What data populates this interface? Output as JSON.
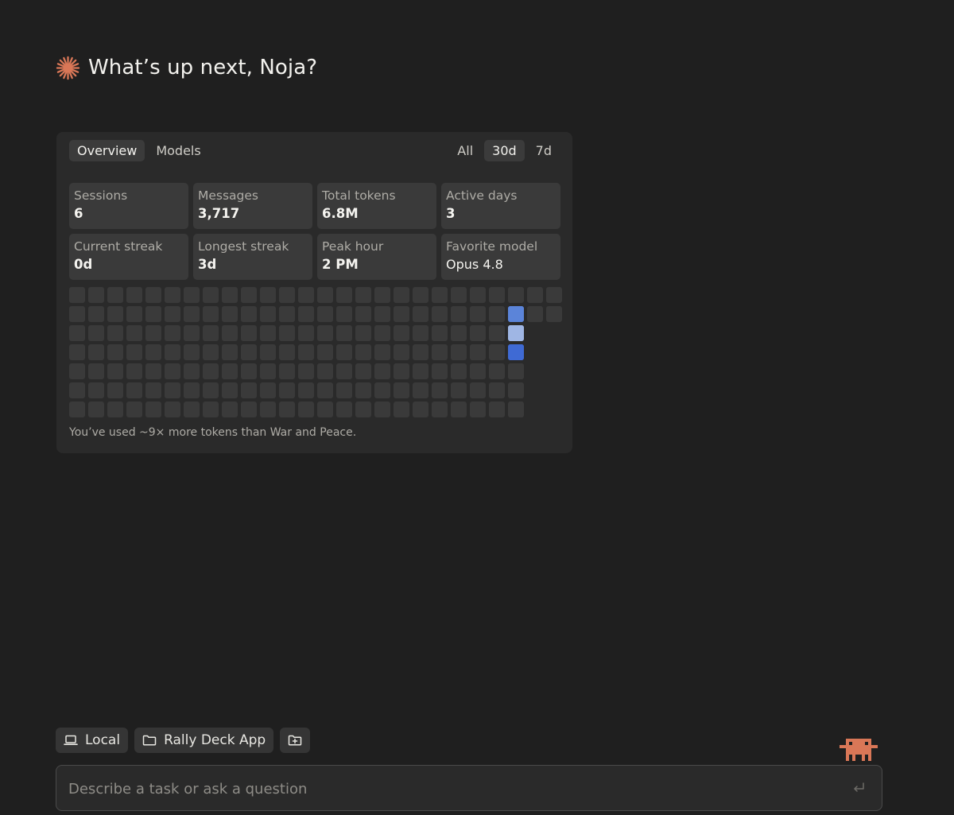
{
  "greeting": {
    "text": "What’s up next, Noja?",
    "icon": "sparkle-icon",
    "accent": "#d97757"
  },
  "tabs": [
    {
      "label": "Overview",
      "active": true
    },
    {
      "label": "Models",
      "active": false
    }
  ],
  "ranges": [
    {
      "label": "All",
      "active": false
    },
    {
      "label": "30d",
      "active": true
    },
    {
      "label": "7d",
      "active": false
    }
  ],
  "stats": [
    {
      "label": "Sessions",
      "value": "6"
    },
    {
      "label": "Messages",
      "value": "3,717"
    },
    {
      "label": "Total tokens",
      "value": "6.8M"
    },
    {
      "label": "Active days",
      "value": "3"
    },
    {
      "label": "Current streak",
      "value": "0d"
    },
    {
      "label": "Longest streak",
      "value": "3d"
    },
    {
      "label": "Peak hour",
      "value": "2 PM"
    },
    {
      "label": "Favorite model",
      "value": "Opus 4.8"
    }
  ],
  "heatmap": {
    "rows": 7,
    "cols": 26,
    "empty_color": "#3a3a3a",
    "active": [
      {
        "row": 1,
        "col": 23,
        "color": "#5b84d9"
      },
      {
        "row": 2,
        "col": 23,
        "color": "#9fb6e4"
      },
      {
        "row": 3,
        "col": 23,
        "color": "#3f6ad4"
      }
    ],
    "extra_cells": [
      {
        "row": 0,
        "col": 24
      },
      {
        "row": 0,
        "col": 25
      },
      {
        "row": 1,
        "col": 24
      },
      {
        "row": 1,
        "col": 25
      }
    ],
    "trailing_col": 24
  },
  "footnote": "You’ve used ~9× more tokens than War and Peace.",
  "chips": {
    "local": {
      "label": "Local",
      "icon": "laptop-icon"
    },
    "project": {
      "label": "Rally Deck App",
      "icon": "folder-icon"
    },
    "add": {
      "icon": "folder-plus-icon"
    }
  },
  "input": {
    "placeholder": "Describe a task or ask a question"
  },
  "mascot": {
    "icon": "pixel-creature-icon",
    "color": "#d97757"
  }
}
